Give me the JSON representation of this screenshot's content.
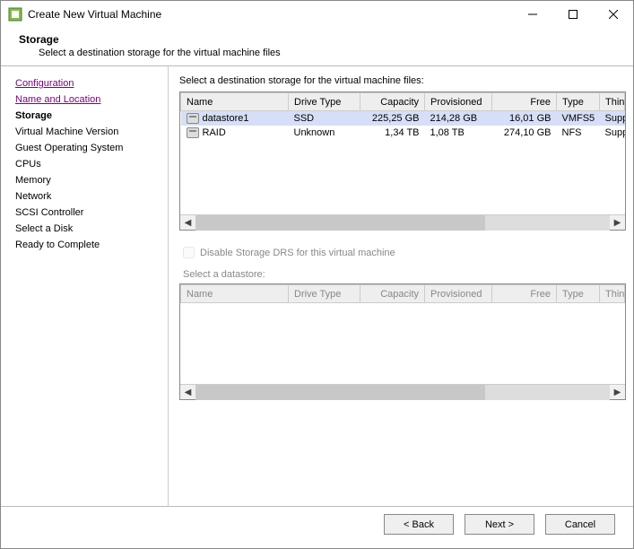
{
  "window": {
    "title": "Create New Virtual Machine"
  },
  "header": {
    "title": "Storage",
    "subtitle": "Select a destination storage for the virtual machine files"
  },
  "sidebar": {
    "steps": [
      {
        "label": "Configuration",
        "state": "visited"
      },
      {
        "label": "Name and Location",
        "state": "visited"
      },
      {
        "label": "Storage",
        "state": "current"
      },
      {
        "label": "Virtual Machine Version",
        "state": ""
      },
      {
        "label": "Guest Operating System",
        "state": ""
      },
      {
        "label": "CPUs",
        "state": ""
      },
      {
        "label": "Memory",
        "state": ""
      },
      {
        "label": "Network",
        "state": ""
      },
      {
        "label": "SCSI Controller",
        "state": ""
      },
      {
        "label": "Select a Disk",
        "state": ""
      },
      {
        "label": "Ready to Complete",
        "state": ""
      }
    ]
  },
  "content": {
    "instruction": "Select a destination storage for the virtual machine files:",
    "columns": {
      "name": "Name",
      "drive_type": "Drive Type",
      "capacity": "Capacity",
      "provisioned": "Provisioned",
      "free": "Free",
      "type": "Type",
      "thin": "Thin Pr"
    },
    "rows": [
      {
        "name": "datastore1",
        "drive_type": "SSD",
        "capacity": "225,25 GB",
        "provisioned": "214,28 GB",
        "free": "16,01 GB",
        "type": "VMFS5",
        "thin": "Suppor",
        "selected": true
      },
      {
        "name": "RAID",
        "drive_type": "Unknown",
        "capacity": "1,34 TB",
        "provisioned": "1,08 TB",
        "free": "274,10 GB",
        "type": "NFS",
        "thin": "Suppor",
        "selected": false
      }
    ],
    "drs_label": "Disable Storage DRS for this virtual machine",
    "select_ds_label": "Select a datastore:",
    "lower_columns": {
      "name": "Name",
      "drive_type": "Drive Type",
      "capacity": "Capacity",
      "provisioned": "Provisioned",
      "free": "Free",
      "type": "Type",
      "thin": "Thin Pro"
    }
  },
  "footer": {
    "back": "< Back",
    "next": "Next >",
    "cancel": "Cancel"
  }
}
